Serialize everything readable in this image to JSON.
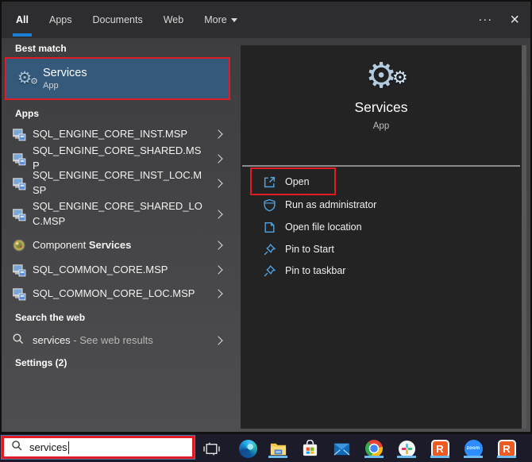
{
  "tabs": [
    {
      "label": "All",
      "active": true
    },
    {
      "label": "Apps",
      "active": false
    },
    {
      "label": "Documents",
      "active": false
    },
    {
      "label": "Web",
      "active": false
    },
    {
      "label": "More",
      "active": false,
      "has_dropdown": true
    }
  ],
  "topbar": {
    "overflow_menu": "···",
    "close": "×"
  },
  "left": {
    "best_match_header": "Best match",
    "best_match": {
      "title": "Services",
      "subtitle": "App"
    },
    "apps_header": "Apps",
    "app_items": [
      {
        "label": "SQL_ENGINE_CORE_INST.MSP",
        "icon": "installer"
      },
      {
        "label": "SQL_ENGINE_CORE_SHARED.MSP",
        "icon": "installer"
      },
      {
        "label": "SQL_ENGINE_CORE_INST_LOC.MSP",
        "icon": "installer"
      },
      {
        "label": "SQL_ENGINE_CORE_SHARED_LOC.MSP",
        "icon": "installer"
      },
      {
        "prefix": "Component ",
        "match": "Services",
        "icon": "component-services"
      },
      {
        "label": "SQL_COMMON_CORE.MSP",
        "icon": "installer"
      },
      {
        "label": "SQL_COMMON_CORE_LOC.MSP",
        "icon": "installer"
      }
    ],
    "web_header": "Search the web",
    "web_item": {
      "term": "services",
      "suffix": " - See web results"
    },
    "settings_header": "Settings (2)"
  },
  "right": {
    "app_title": "Services",
    "app_subtitle": "App",
    "actions": [
      {
        "label": "Open",
        "icon": "open-icon",
        "annotated": true
      },
      {
        "label": "Run as administrator",
        "icon": "shield-icon"
      },
      {
        "label": "Open file location",
        "icon": "file-location-icon"
      },
      {
        "label": "Pin to Start",
        "icon": "pin-icon"
      },
      {
        "label": "Pin to taskbar",
        "icon": "pin-icon"
      }
    ]
  },
  "taskbar": {
    "search_value": "services",
    "zoom_label": "zoom",
    "r_label": "R",
    "icons": [
      {
        "name": "task-view",
        "running": false
      },
      {
        "name": "edge",
        "running": false
      },
      {
        "name": "file-explorer",
        "running": true
      },
      {
        "name": "microsoft-store",
        "running": false
      },
      {
        "name": "mail",
        "running": false
      },
      {
        "name": "chrome",
        "running": true
      },
      {
        "name": "slack",
        "running": true
      },
      {
        "name": "ringcentral",
        "running": true
      },
      {
        "name": "zoom",
        "running": true
      },
      {
        "name": "ringcentral-2",
        "running": true
      }
    ]
  },
  "colors": {
    "accent_blue": "#1a7fd4",
    "highlight_blue": "#35597b",
    "annotation_red": "#e01b24",
    "icon_blue": "#4fa3e3",
    "taskbar_navy": "#1b1b29",
    "running_indicator": "#6cb8f0",
    "orange_app": "#f0591f",
    "zoom_blue": "#2d8cff"
  }
}
